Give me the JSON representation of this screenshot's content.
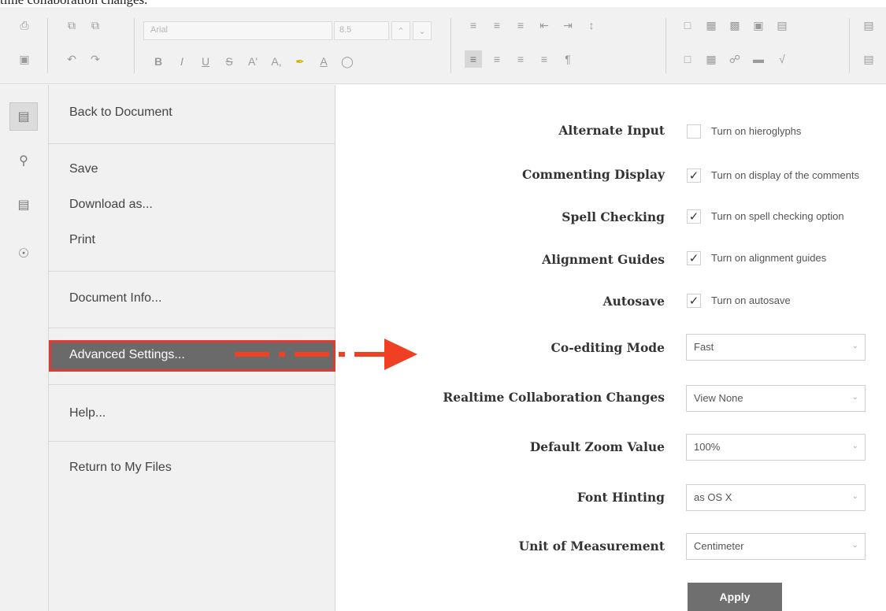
{
  "caption": "time collaboration changes.",
  "toolbar": {
    "font_name": "Arial",
    "font_size": "8.5"
  },
  "menu": {
    "items": [
      {
        "label": "Back to Document"
      },
      {
        "label": "Save"
      },
      {
        "label": "Download as..."
      },
      {
        "label": "Print"
      },
      {
        "label": "Document Info..."
      },
      {
        "label": "Advanced Settings..."
      },
      {
        "label": "Help..."
      },
      {
        "label": "Return to My Files"
      }
    ],
    "highlighted": "Advanced Settings..."
  },
  "annotation": {
    "color": "#ef4023"
  },
  "settings": {
    "alternate_input": {
      "label": "Alternate Input",
      "option": "Turn on hieroglyphs",
      "checked": false
    },
    "commenting_display": {
      "label": "Commenting Display",
      "option": "Turn on display of the comments",
      "checked": true
    },
    "spell_checking": {
      "label": "Spell Checking",
      "option": "Turn on spell checking option",
      "checked": true
    },
    "alignment_guides": {
      "label": "Alignment Guides",
      "option": "Turn on alignment guides",
      "checked": true
    },
    "autosave": {
      "label": "Autosave",
      "option": "Turn on autosave",
      "checked": true
    },
    "coediting_mode": {
      "label": "Co-editing Mode",
      "value": "Fast"
    },
    "realtime_changes": {
      "label": "Realtime Collaboration Changes",
      "value": "View None"
    },
    "default_zoom": {
      "label": "Default Zoom Value",
      "value": "100%"
    },
    "font_hinting": {
      "label": "Font Hinting",
      "value": "as OS X"
    },
    "unit_of_measurement": {
      "label": "Unit of Measurement",
      "value": "Centimeter"
    },
    "apply_label": "Apply"
  },
  "icons": {
    "check": "✓",
    "chevron": "⌄"
  }
}
